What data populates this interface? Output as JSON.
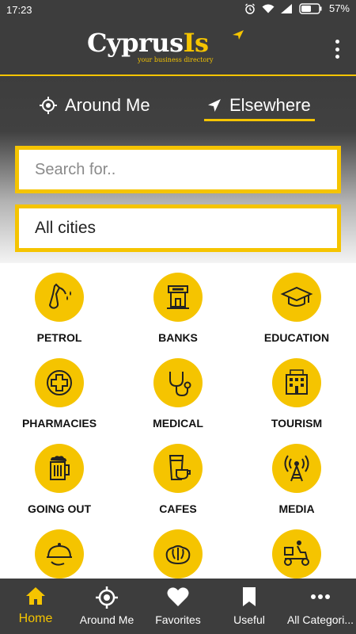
{
  "status_bar": {
    "time": "17:23",
    "battery": "57%"
  },
  "header": {
    "logo_main_1": "Cyprus",
    "logo_main_2": "Is",
    "logo_tagline": "your business directory"
  },
  "location_tabs": [
    {
      "label": "Around Me"
    },
    {
      "label": "Elsewhere"
    }
  ],
  "search": {
    "placeholder": "Search for..",
    "city": "All cities"
  },
  "categories": [
    {
      "label": "PETROL",
      "icon": "fuel-pump-icon"
    },
    {
      "label": "BANKS",
      "icon": "bank-icon"
    },
    {
      "label": "EDUCATION",
      "icon": "graduation-cap-icon"
    },
    {
      "label": "PHARMACIES",
      "icon": "medical-cross-icon"
    },
    {
      "label": "MEDICAL",
      "icon": "stethoscope-icon"
    },
    {
      "label": "TOURISM",
      "icon": "hotel-icon"
    },
    {
      "label": "GOING OUT",
      "icon": "beer-mug-icon"
    },
    {
      "label": "CAFES",
      "icon": "coffee-cup-icon"
    },
    {
      "label": "MEDIA",
      "icon": "broadcast-tower-icon"
    },
    {
      "label": "",
      "icon": "food-cloche-icon"
    },
    {
      "label": "",
      "icon": "bread-icon"
    },
    {
      "label": "",
      "icon": "delivery-scooter-icon"
    }
  ],
  "bottom_nav": [
    {
      "label": "Home",
      "icon": "home-icon",
      "active": true
    },
    {
      "label": "Around Me",
      "icon": "crosshair-icon"
    },
    {
      "label": "Favorites",
      "icon": "heart-icon"
    },
    {
      "label": "Useful",
      "icon": "bookmark-icon"
    },
    {
      "label": "All Categori...",
      "icon": "more-dots-icon"
    }
  ],
  "colors": {
    "accent": "#f5c400",
    "dark": "#3d3d3d"
  }
}
